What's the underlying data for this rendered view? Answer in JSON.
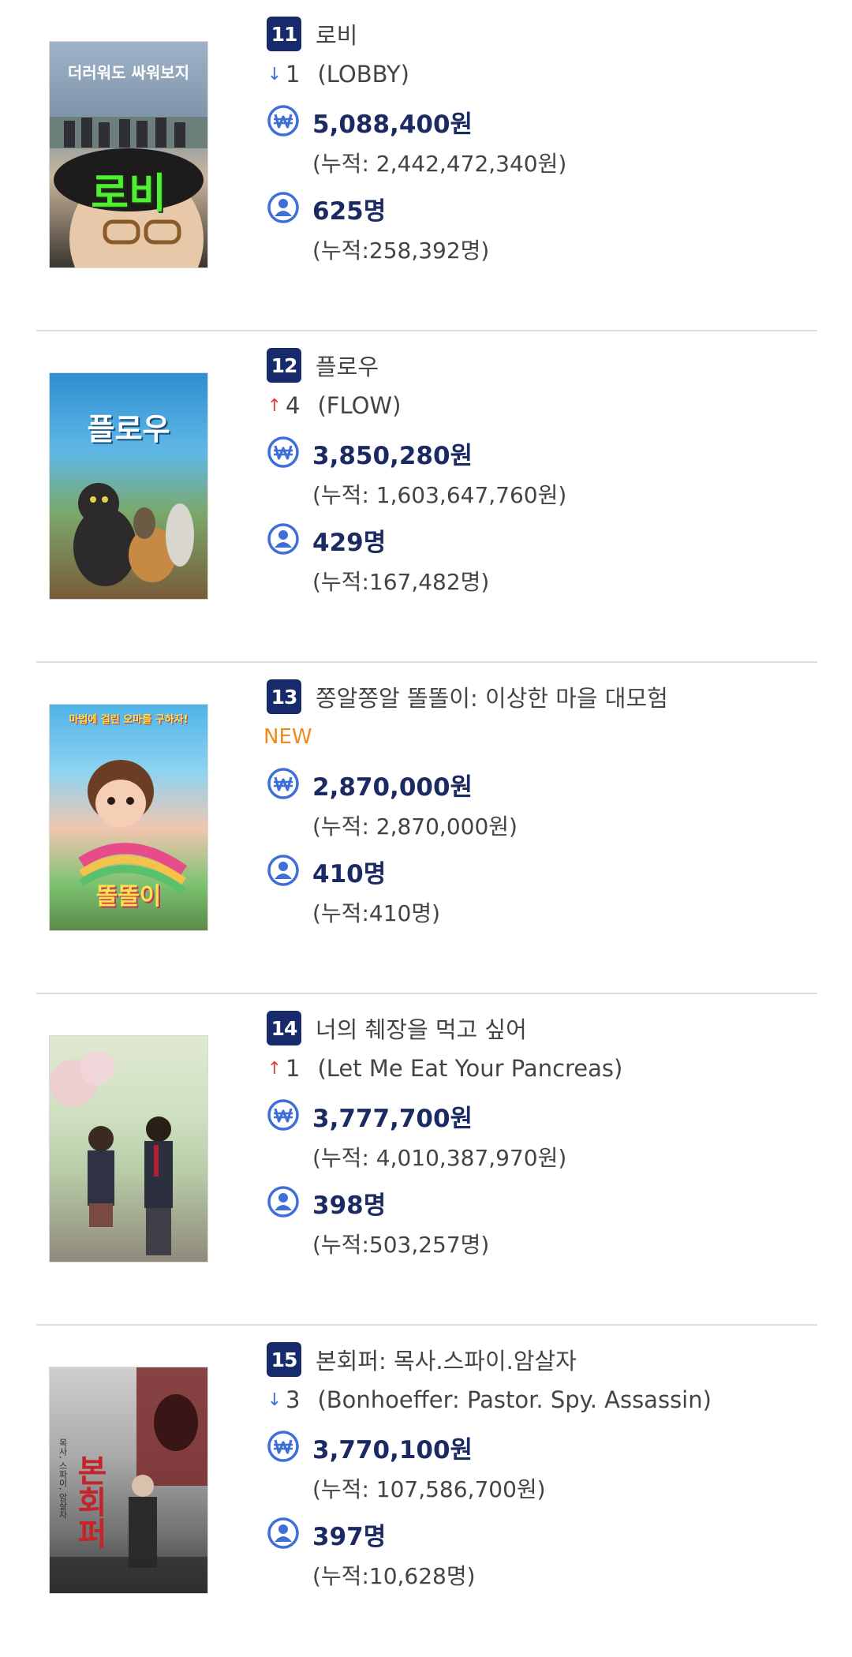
{
  "movies": [
    {
      "rank": "11",
      "title": "로비",
      "change_direction": "down",
      "change_value": "1",
      "original_title": "(LOBBY)",
      "revenue": "5,088,400원",
      "cumulative_revenue": "(누적: 2,442,472,340원)",
      "audience": "625명",
      "cumulative_audience": "(누적:258,392명)",
      "poster_text": "로비",
      "poster_subtext": "더러워도 싸워보지"
    },
    {
      "rank": "12",
      "title": "플로우",
      "change_direction": "up",
      "change_value": "4",
      "original_title": "(FLOW)",
      "revenue": "3,850,280원",
      "cumulative_revenue": "(누적: 1,603,647,760원)",
      "audience": "429명",
      "cumulative_audience": "(누적:167,482명)",
      "poster_text": "플로우",
      "poster_subtext": ""
    },
    {
      "rank": "13",
      "title": "쫑알쫑알 똘똘이: 이상한 마을 대모험",
      "change_direction": "new",
      "change_value": "NEW",
      "original_title": "",
      "revenue": "2,870,000원",
      "cumulative_revenue": "(누적: 2,870,000원)",
      "audience": "410명",
      "cumulative_audience": "(누적:410명)",
      "poster_text": "똘똘이",
      "poster_subtext": "마법에 걸린 오마를 구하자!"
    },
    {
      "rank": "14",
      "title": "너의 췌장을 먹고 싶어",
      "change_direction": "up",
      "change_value": "1",
      "original_title": "(Let Me Eat Your Pancreas)",
      "revenue": "3,777,700원",
      "cumulative_revenue": "(누적: 4,010,387,970원)",
      "audience": "398명",
      "cumulative_audience": "(누적:503,257명)",
      "poster_text": "",
      "poster_subtext": ""
    },
    {
      "rank": "15",
      "title": "본회퍼: 목사.스파이.암살자",
      "change_direction": "down",
      "change_value": "3",
      "original_title": "(Bonhoeffer: Pastor. Spy. Assassin)",
      "revenue": "3,770,100원",
      "cumulative_revenue": "(누적: 107,586,700원)",
      "audience": "397명",
      "cumulative_audience": "(누적:10,628명)",
      "poster_text": "본회퍼",
      "poster_subtext": "목사, 스파이, 암살자"
    }
  ],
  "icons": {
    "money": "won-circle-icon",
    "audience": "person-circle-icon"
  },
  "colors": {
    "rank_bg": "#172a6b",
    "value_text": "#1b2a63",
    "icon_blue": "#3e6fd8",
    "up_arrow": "#e0403a",
    "down_arrow": "#3e6fd8",
    "new_badge": "#f08a1f"
  }
}
